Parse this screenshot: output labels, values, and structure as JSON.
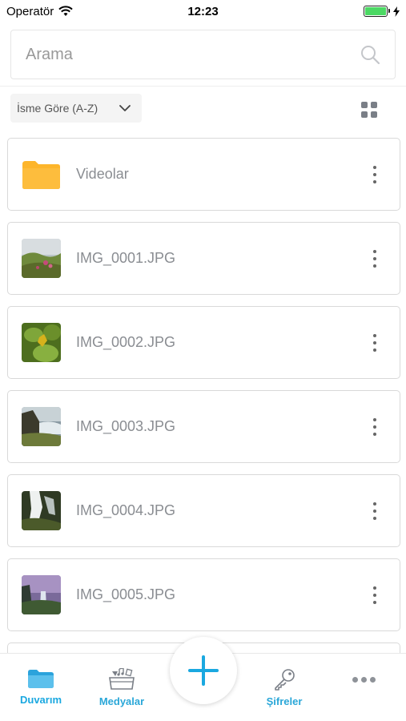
{
  "status_bar": {
    "carrier": "Operatör",
    "time": "12:23",
    "battery_level": 1.0
  },
  "search": {
    "placeholder": "Arama",
    "icon": "search-icon"
  },
  "sort": {
    "selected": "İsme Göre (A-Z)",
    "icon": "chevron-down-icon"
  },
  "view_toggle": {
    "icon": "grid-view-icon"
  },
  "files": [
    {
      "name": "Videolar",
      "type": "folder",
      "icon": "folder-icon"
    },
    {
      "name": "IMG_0001.JPG",
      "type": "image",
      "icon": "image-thumbnail"
    },
    {
      "name": "IMG_0002.JPG",
      "type": "image",
      "icon": "image-thumbnail"
    },
    {
      "name": "IMG_0003.JPG",
      "type": "image",
      "icon": "image-thumbnail"
    },
    {
      "name": "IMG_0004.JPG",
      "type": "image",
      "icon": "image-thumbnail"
    },
    {
      "name": "IMG_0005.JPG",
      "type": "image",
      "icon": "image-thumbnail"
    }
  ],
  "tabs": {
    "wall": {
      "label": "Duvarım",
      "icon": "folder-icon"
    },
    "media": {
      "label": "Medyalar",
      "icon": "media-icon"
    },
    "add": {
      "icon": "plus-icon"
    },
    "passwords": {
      "label": "Şifreler",
      "icon": "key-icon"
    },
    "more": {
      "icon": "more-horizontal-icon"
    }
  },
  "colors": {
    "accent": "#1aa8e0",
    "folder": "#fdb52b",
    "card_border": "#d9d9d9"
  }
}
